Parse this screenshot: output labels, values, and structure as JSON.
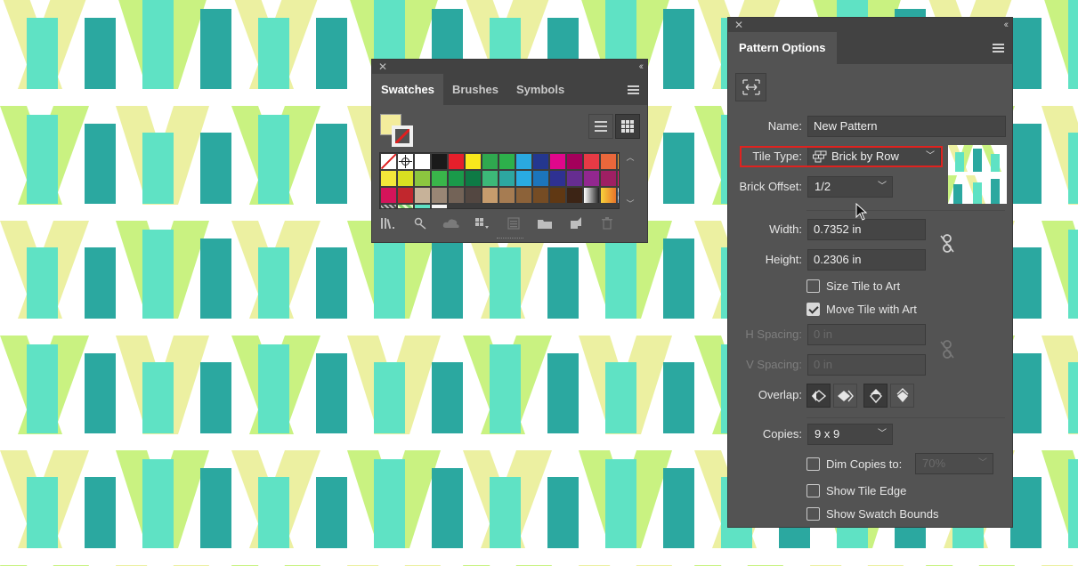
{
  "colors": {
    "pattern_light_yellow": "#ecf0a1",
    "pattern_lime": "#c9f281",
    "pattern_aqua": "#5fe2c4",
    "pattern_teal": "#2ba8a0",
    "panel_bg": "#535353",
    "highlight_red": "#e0221f"
  },
  "swatches_panel": {
    "tabs": [
      "Swatches",
      "Brushes",
      "Symbols"
    ],
    "active_tab": "Swatches",
    "fill_color": "#f3ec9c",
    "swatch_colors": [
      "none",
      "registration",
      "#ffffff",
      "#1a1a1a",
      "#e51f2b",
      "#f8e81c",
      "#2fa84f",
      "#2db04b",
      "#2aa9e0",
      "#24378f",
      "#e0078b",
      "#a4005b",
      "#e63a45",
      "#e9673b",
      "#f3a33c",
      "#f3e83a",
      "#d9e021",
      "#8cc63f",
      "#39b54a",
      "#1a9a4a",
      "#0e7a45",
      "#3cb878",
      "#2da7a0",
      "#29abe2",
      "#1c75bc",
      "#2e3192",
      "#662d91",
      "#92278f",
      "#9e1f63",
      "#ed1e79",
      "#d4145a",
      "#c1272d",
      "#c7b299",
      "#998675",
      "#736357",
      "#534741",
      "#c69c6d",
      "#a67c52",
      "#8c6239",
      "#754c24",
      "#603813",
      "#3c2415",
      "gradient-bw",
      "gradient-orange",
      "pattern-blue",
      "pattern-dark",
      "pattern-green",
      "#5fe2c4",
      "pattern-white"
    ]
  },
  "pattern_panel": {
    "title": "Pattern Options",
    "name_label": "Name:",
    "name_value": "New Pattern",
    "tile_type_label": "Tile Type:",
    "tile_type_value": "Brick by Row",
    "brick_offset_label": "Brick Offset:",
    "brick_offset_value": "1/2",
    "width_label": "Width:",
    "width_value": "0.7352 in",
    "height_label": "Height:",
    "height_value": "0.2306 in",
    "size_tile_label": "Size Tile to Art",
    "size_tile_checked": false,
    "move_tile_label": "Move Tile with Art",
    "move_tile_checked": true,
    "h_spacing_label": "H Spacing:",
    "h_spacing_value": "0 in",
    "v_spacing_label": "V Spacing:",
    "v_spacing_value": "0 in",
    "overlap_label": "Overlap:",
    "copies_label": "Copies:",
    "copies_value": "9 x 9",
    "dim_copies_label": "Dim Copies to:",
    "dim_copies_checked": false,
    "dim_copies_value": "70%",
    "show_tile_edge_label": "Show Tile Edge",
    "show_tile_edge_checked": false,
    "show_swatch_bounds_label": "Show Swatch Bounds",
    "show_swatch_bounds_checked": false
  }
}
